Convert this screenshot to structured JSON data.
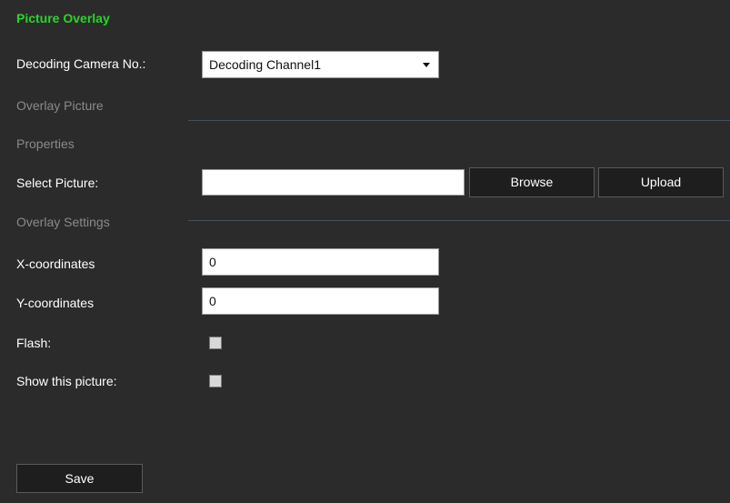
{
  "page": {
    "title": "Picture Overlay"
  },
  "decoding": {
    "label": "Decoding Camera No.:",
    "selected": "Decoding Channel1"
  },
  "sections": {
    "overlay_picture": "Overlay Picture",
    "properties": "Properties",
    "overlay_settings": "Overlay Settings"
  },
  "select_picture": {
    "label": "Select Picture:",
    "value": "",
    "browse_label": "Browse",
    "upload_label": "Upload"
  },
  "x_coord": {
    "label": "X-coordinates",
    "value": "0"
  },
  "y_coord": {
    "label": "Y-coordinates",
    "value": "0"
  },
  "flash": {
    "label": "Flash:",
    "checked": false
  },
  "show_picture": {
    "label": "Show this picture:",
    "checked": false
  },
  "save_label": "Save",
  "colors": {
    "background": "#2b2b2b",
    "title": "#2ad42a",
    "section": "#8a8a8a",
    "button_bg": "#1e1e1e"
  }
}
